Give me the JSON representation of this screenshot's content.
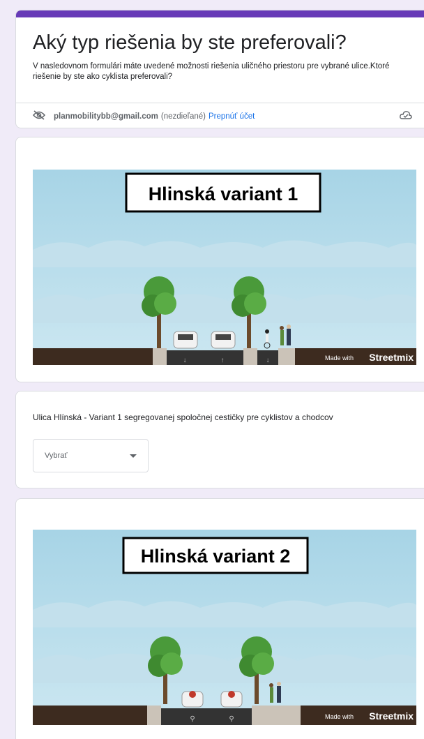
{
  "form": {
    "title": "Aký typ riešenia by ste preferovali?",
    "description": "V nasledovnom formulári máte uvedené možnosti riešenia uličného priestoru pre vybrané ulice.Ktoré riešenie by ste ako cyklista preferovali?",
    "accent_color": "#673ab7"
  },
  "account": {
    "email": "planmobilitybb@gmail.com",
    "shared_status": "(nezdieľané)",
    "switch_label": "Prepnúť účet",
    "hidden_icon": "eye-off-icon",
    "cloud_icon": "cloud-saved-icon"
  },
  "images": [
    {
      "sign_text": "Hlinská variant 1",
      "watermark_prefix": "Made with",
      "watermark_brand": "Streetmix"
    },
    {
      "sign_text": "Hlinská variant 2",
      "watermark_prefix": "Made with",
      "watermark_brand": "Streetmix"
    }
  ],
  "question": {
    "text": "Ulica Hlínská - Variant 1 segregovanej spoločnej cestičky pre cyklistov a chodcov",
    "dropdown_value": "Vybrať"
  }
}
